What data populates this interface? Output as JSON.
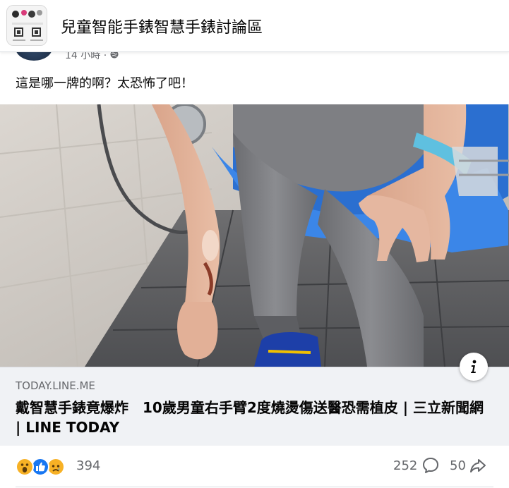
{
  "group": {
    "title": "兒童智能手錶智慧手錶討論區",
    "logo_icon": "group-cover-thumbnail"
  },
  "post": {
    "time": "14 小時 ·",
    "privacy_icon": "globe-icon",
    "text": "這是哪一牌的啊？太恐怖了吧！",
    "photo_icon": "news-photo-burned-arm"
  },
  "link_card": {
    "domain": "TODAY.LINE.ME",
    "title": "戴智慧手錶竟爆炸　10歲男童右手臂2度燒燙傷送醫恐需植皮 | 三立新聞網 | LINE TODAY",
    "info_icon": "info-icon"
  },
  "stats": {
    "reactions": [
      "wow-icon",
      "like-icon",
      "sad-icon"
    ],
    "reaction_count": "394",
    "comment_count": "252",
    "share_count": "50"
  },
  "colors": {
    "like_blue": "#1877f2",
    "reaction_yellow": "#f7b125",
    "secondary_text": "#65676b",
    "card_background": "#f0f2f5"
  }
}
